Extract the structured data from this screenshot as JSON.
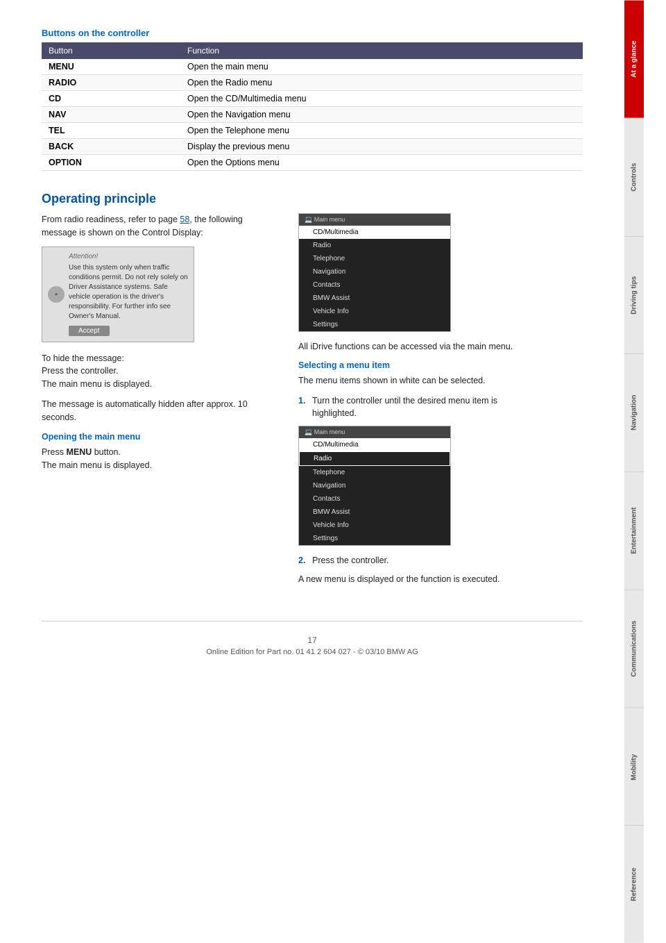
{
  "page": {
    "number": "17",
    "footer_text": "Online Edition for Part no. 01 41 2 604 027 - © 03/10 BMW AG"
  },
  "side_tabs": [
    {
      "id": "at-a-glance",
      "label": "At a glance",
      "active": true
    },
    {
      "id": "controls",
      "label": "Controls",
      "active": false
    },
    {
      "id": "driving-tips",
      "label": "Driving tips",
      "active": false
    },
    {
      "id": "navigation",
      "label": "Navigation",
      "active": false
    },
    {
      "id": "entertainment",
      "label": "Entertainment",
      "active": false
    },
    {
      "id": "communications",
      "label": "Communications",
      "active": false
    },
    {
      "id": "mobility",
      "label": "Mobility",
      "active": false
    },
    {
      "id": "reference",
      "label": "Reference",
      "active": false
    }
  ],
  "buttons_section": {
    "title": "Buttons on the controller",
    "table_headers": [
      "Button",
      "Function"
    ],
    "table_rows": [
      {
        "button": "MENU",
        "function": "Open the main menu"
      },
      {
        "button": "RADIO",
        "function": "Open the Radio menu"
      },
      {
        "button": "CD",
        "function": "Open the CD/Multimedia menu"
      },
      {
        "button": "NAV",
        "function": "Open the Navigation menu"
      },
      {
        "button": "TEL",
        "function": "Open the Telephone menu"
      },
      {
        "button": "BACK",
        "function": "Display the previous menu"
      },
      {
        "button": "OPTION",
        "function": "Open the Options menu"
      }
    ]
  },
  "operating_principle": {
    "heading": "Operating principle",
    "intro_text": "From radio readiness, refer to page 58, the following message is shown on the Control Display:",
    "attention_box": {
      "header": "Attention!",
      "body": "Use this system only when traffic conditions permit. Do not rely solely on Driver Assistance systems. Safe vehicle operation is the driver's responsibility. For further info see Owner's Manual.",
      "accept_button": "Accept"
    },
    "hide_message_text": "To hide the message:\nPress the controller.\nThe main menu is displayed.",
    "auto_hidden_text": "The message is automatically hidden after approx. 10 seconds.",
    "opening_main_menu": {
      "subheading": "Opening the main menu",
      "text": "Press MENU button.",
      "text2": "The main menu is displayed."
    },
    "main_menu_items": [
      {
        "label": "CD/Multimedia",
        "selected": true
      },
      {
        "label": "Radio",
        "selected": false
      },
      {
        "label": "Telephone",
        "selected": false
      },
      {
        "label": "Navigation",
        "selected": false
      },
      {
        "label": "Contacts",
        "selected": false
      },
      {
        "label": "BMW Assist",
        "selected": false
      },
      {
        "label": "Vehicle Info",
        "selected": false
      },
      {
        "label": "Settings",
        "selected": false
      }
    ],
    "all_idrive_text": "All iDrive functions can be accessed via the main menu.",
    "selecting_menu_item": {
      "subheading": "Selecting a menu item",
      "intro": "The menu items shown in white can be selected.",
      "steps": [
        "Turn the controller until the desired menu item is highlighted.",
        "Press the controller."
      ],
      "step2_after": "A new menu is displayed or the function is executed."
    },
    "main_menu_items_2": [
      {
        "label": "CD/Multimedia",
        "selected": true
      },
      {
        "label": "Radio",
        "highlighted": true
      },
      {
        "label": "Telephone",
        "selected": false
      },
      {
        "label": "Navigation",
        "selected": false
      },
      {
        "label": "Contacts",
        "selected": false
      },
      {
        "label": "BMW Assist",
        "selected": false
      },
      {
        "label": "Vehicle Info",
        "selected": false
      },
      {
        "label": "Settings",
        "selected": false
      }
    ]
  }
}
